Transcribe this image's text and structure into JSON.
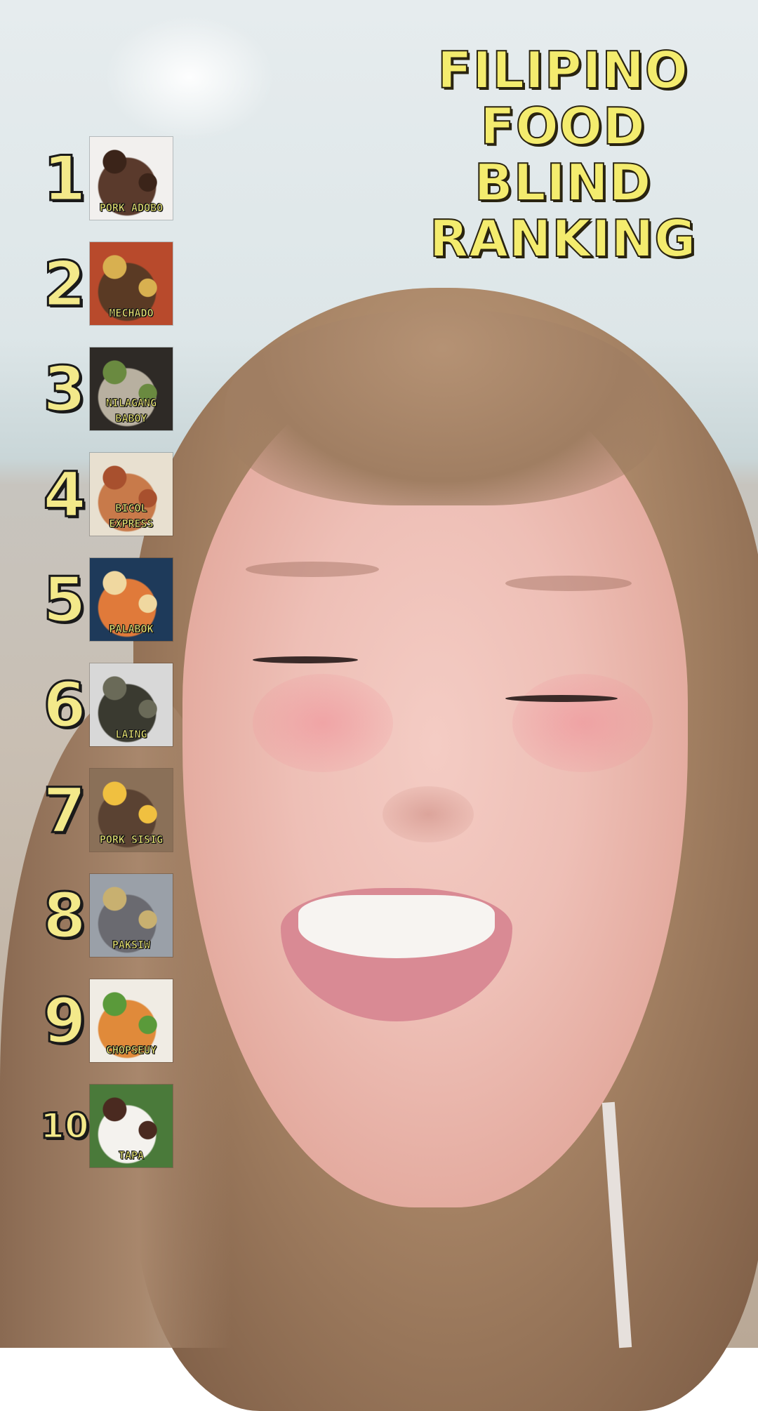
{
  "title_lines": [
    "FILIPINO",
    "FOOD",
    "BLIND",
    "RANKING"
  ],
  "ranking": [
    {
      "rank": "1",
      "label": "PORK ADOBO",
      "colors": [
        "#f2f0ee",
        "#5a3a2c",
        "#3b2419"
      ]
    },
    {
      "rank": "2",
      "label": "MECHADO",
      "colors": [
        "#b84a2c",
        "#5a3a24",
        "#d8b050"
      ]
    },
    {
      "rank": "3",
      "label": "NILAGANG BABOY",
      "colors": [
        "#2e2a26",
        "#b8b0a0",
        "#6a8a40"
      ]
    },
    {
      "rank": "4",
      "label": "BICOL EXPRESS",
      "colors": [
        "#e8e0d0",
        "#c87a4a",
        "#a8502e"
      ]
    },
    {
      "rank": "5",
      "label": "PALABOK",
      "colors": [
        "#1e3a5a",
        "#e07a3a",
        "#f0d8a0"
      ]
    },
    {
      "rank": "6",
      "label": "LAING",
      "colors": [
        "#d8d8d8",
        "#3a3a30",
        "#6a6a58"
      ]
    },
    {
      "rank": "7",
      "label": "PORK SISIG",
      "colors": [
        "#8a7058",
        "#5a4232",
        "#f0c040"
      ]
    },
    {
      "rank": "8",
      "label": "PAKSIW",
      "colors": [
        "#9aa0a8",
        "#6a6a70",
        "#c8b070"
      ]
    },
    {
      "rank": "9",
      "label": "CHOPSEUY",
      "colors": [
        "#f0ece4",
        "#e08a3a",
        "#5a9a3a"
      ]
    },
    {
      "rank": "10",
      "label": "TAPA",
      "colors": [
        "#4a7a3a",
        "#f4f2ee",
        "#4a2a20"
      ]
    }
  ]
}
